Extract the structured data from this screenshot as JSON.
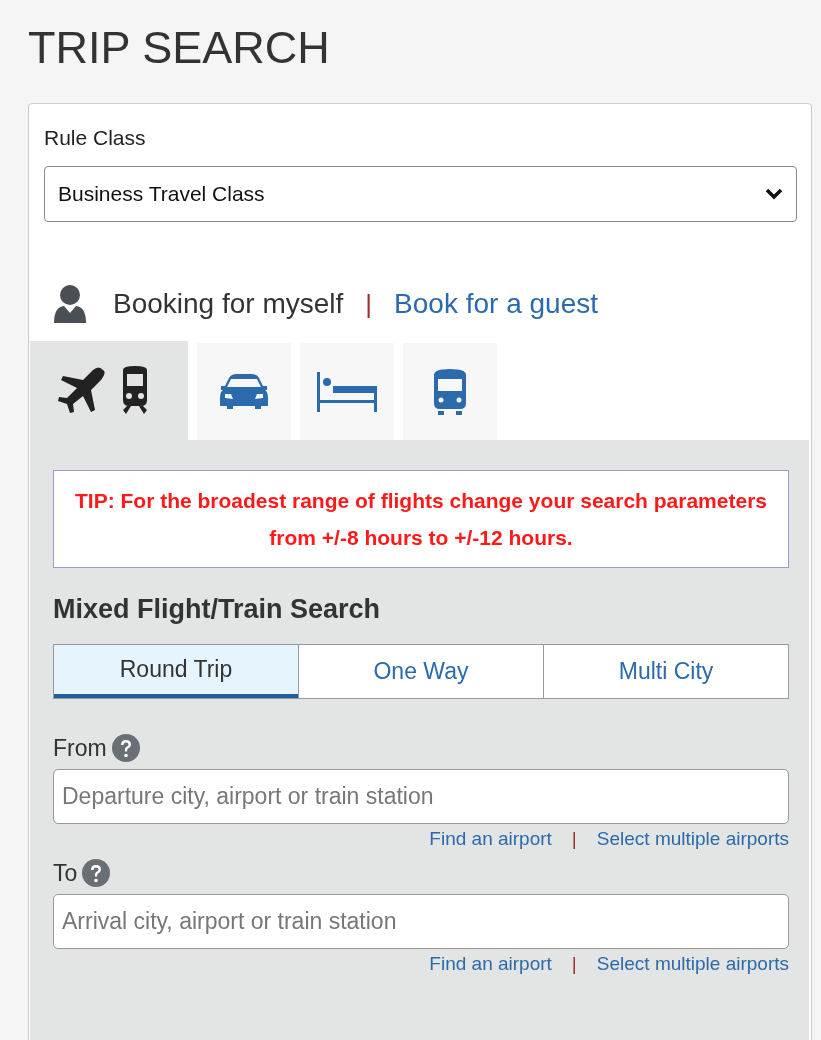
{
  "title": "TRIP SEARCH",
  "rule_class": {
    "label": "Rule Class",
    "value": "Business Travel Class"
  },
  "booking": {
    "self": "Booking for myself",
    "separator": "|",
    "guest": "Book for a guest"
  },
  "tabs": [
    {
      "kind": "flight-train",
      "selected": true
    },
    {
      "kind": "car",
      "selected": false
    },
    {
      "kind": "hotel",
      "selected": false
    },
    {
      "kind": "train",
      "selected": false
    }
  ],
  "tip": "TIP: For the broadest range of flights change your search parameters from +/-8 hours to +/-12 hours.",
  "search_heading": "Mixed Flight/Train Search",
  "trip_types": [
    {
      "label": "Round Trip",
      "selected": true
    },
    {
      "label": "One Way",
      "selected": false
    },
    {
      "label": "Multi City",
      "selected": false
    }
  ],
  "fields": [
    {
      "label": "From",
      "placeholder": "Departure city, airport or train station",
      "links": [
        "Find an airport",
        "Select multiple airports"
      ],
      "separator": "|"
    },
    {
      "label": "To",
      "placeholder": "Arrival city, airport or train station",
      "links": [
        "Find an airport",
        "Select multiple airports"
      ],
      "separator": "|"
    }
  ]
}
